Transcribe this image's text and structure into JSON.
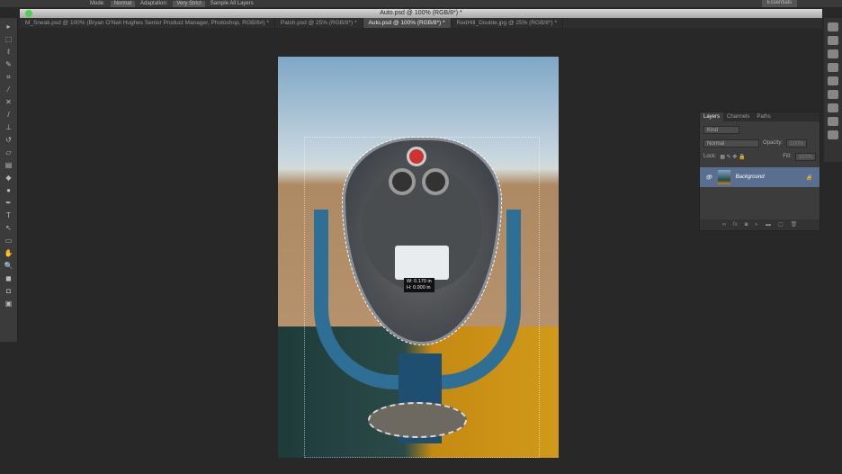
{
  "options_bar": {
    "mode_label": "Mode:",
    "mode_value": "Normal",
    "adaptation_label": "Adaptation:",
    "adaptation_value": "Very Strict",
    "sample_all_layers": "Sample All Layers",
    "workspace": "Essentials"
  },
  "window_title": "Auto.psd @ 100% (RGB/8*) *",
  "tabs": [
    {
      "label": "M_Sneak.psd @ 100% (Bryan O'Neil Hughes Senior Product Manager, Photoshop, RGB/8#) *"
    },
    {
      "label": "Patch.psd @ 25% (RGB/8*) *"
    },
    {
      "label": "Auto.psd @ 100% (RGB/8*) *"
    },
    {
      "label": "RedHill_Double.jpg @ 25% (RGB/8*) *"
    }
  ],
  "measurement": {
    "w": "W: 0.170 in",
    "h": "H: 0.000 in"
  },
  "layers_panel": {
    "tabs": [
      "Layers",
      "Channels",
      "Paths"
    ],
    "filter": "Kind",
    "blend_mode": "Normal",
    "opacity_label": "Opacity:",
    "opacity_value": "100%",
    "lock_label": "Lock:",
    "fill_label": "Fill:",
    "fill_value": "100%",
    "layers": [
      {
        "name": "Background"
      }
    ]
  }
}
